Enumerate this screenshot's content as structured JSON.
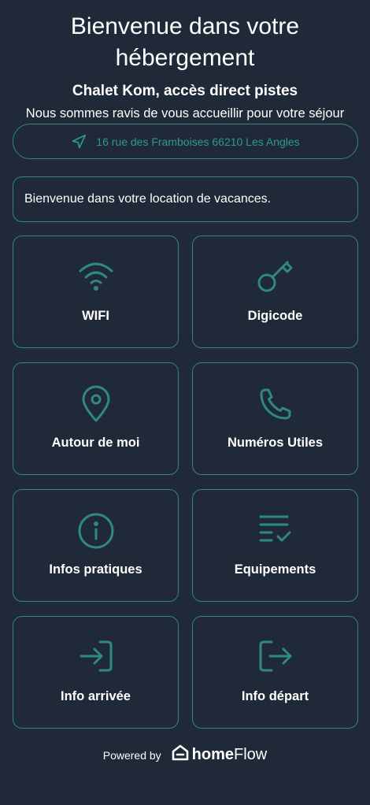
{
  "header": {
    "title": "Bienvenue dans votre hébergement",
    "property_name": "Chalet Kom, accès direct pistes",
    "subtitle": "Nous sommes ravis de vous accueillir pour votre séjour"
  },
  "address": {
    "icon": "navigation-arrow-icon",
    "text": "16 rue des Framboises 66210 Les Angles"
  },
  "welcome_message": "Bienvenue dans votre location de vacances.",
  "tiles": [
    {
      "label": "WIFI",
      "icon": "wifi-icon"
    },
    {
      "label": "Digicode",
      "icon": "key-icon"
    },
    {
      "label": "Autour de moi",
      "icon": "map-pin-icon"
    },
    {
      "label": "Numéros Utiles",
      "icon": "phone-icon"
    },
    {
      "label": "Infos pratiques",
      "icon": "info-circle-icon"
    },
    {
      "label": "Equipements",
      "icon": "checklist-icon"
    },
    {
      "label": "Info arrivée",
      "icon": "login-icon"
    },
    {
      "label": "Info départ",
      "icon": "logout-icon"
    }
  ],
  "footer": {
    "powered_by": "Powered by",
    "brand_bold": "home",
    "brand_light": "Flow",
    "logo_icon": "homeflow-house-logo-icon"
  },
  "colors": {
    "background": "#1f2937",
    "accent": "#2f8a7d",
    "text": "#ffffff"
  }
}
